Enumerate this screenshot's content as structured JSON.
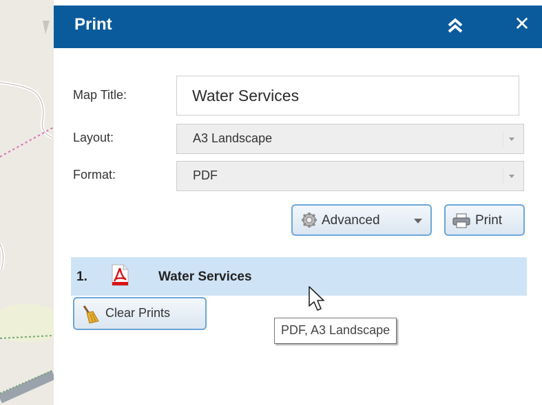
{
  "panel": {
    "title": "Print",
    "collapse_icon": "double-chevron-up-icon",
    "close_icon": "close-icon",
    "close_glyph": "✕"
  },
  "form": {
    "map_title_label": "Map Title:",
    "map_title_value": "Water Services",
    "layout_label": "Layout:",
    "layout_value": "A3 Landscape",
    "format_label": "Format:",
    "format_value": "PDF"
  },
  "buttons": {
    "advanced_label": "Advanced",
    "advanced_icon": "gear-icon",
    "print_label": "Print",
    "print_icon": "printer-icon",
    "clear_label": "Clear Prints",
    "clear_icon": "broom-icon"
  },
  "results": [
    {
      "number": "1.",
      "icon": "pdf-file-icon",
      "title": "Water Services"
    }
  ],
  "tooltip": "PDF, A3 Landscape",
  "colors": {
    "header": "#0a5b9c",
    "result_row": "#cfe3f6",
    "button_border": "#6aa7d8"
  }
}
